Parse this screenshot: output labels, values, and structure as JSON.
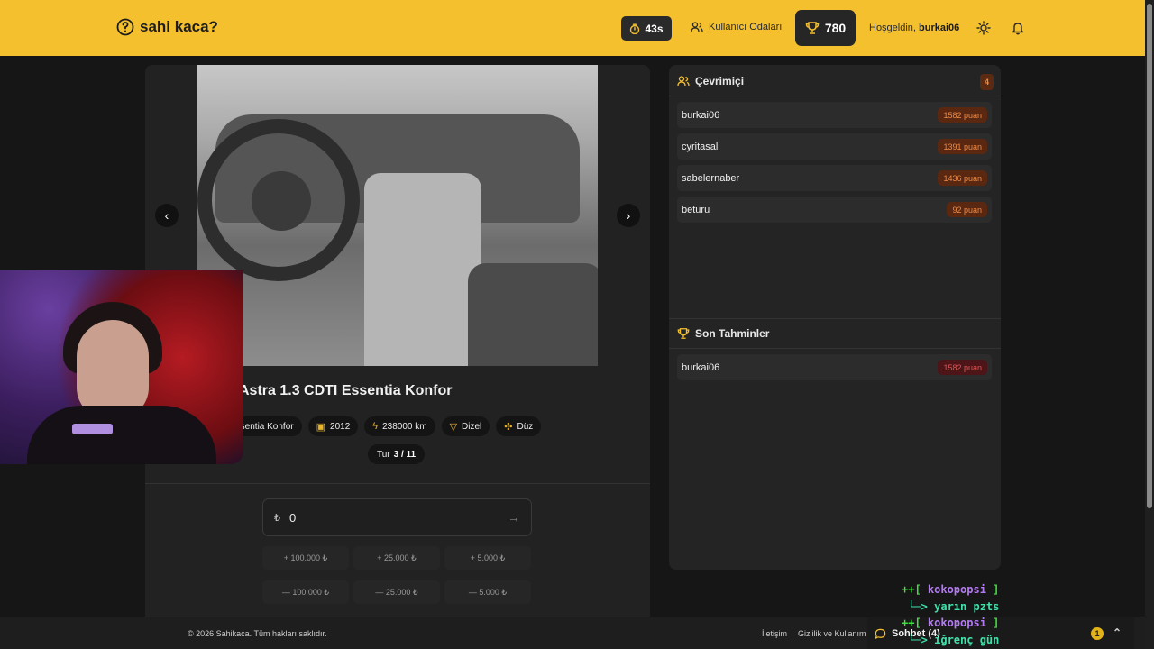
{
  "header": {
    "logo_text": "sahi kaca?",
    "timer": "43s",
    "rooms_label": "Kullanıcı Odaları",
    "score": "780",
    "welcome_prefix": "Hoşgeldin,",
    "username": "burkai06"
  },
  "car": {
    "title": "Astra 1.3 CDTI Essentia Konfor",
    "chips": [
      {
        "icon": "tag-icon",
        "text": "Essentia Konfor"
      },
      {
        "icon": "calendar-icon",
        "text": "2012"
      },
      {
        "icon": "bolt-icon",
        "text": "238000 km"
      },
      {
        "icon": "fuel-icon",
        "text": "Dizel"
      },
      {
        "icon": "gear-icon",
        "text": "Düz"
      }
    ],
    "round_label": "Tur",
    "round_value": "3 / 11"
  },
  "guess": {
    "currency": "₺",
    "value": "0",
    "adjust_buttons": [
      "+ 100.000 ₺",
      "+ 25.000 ₺",
      "+ 5.000 ₺",
      "— 100.000 ₺",
      "— 25.000 ₺",
      "— 5.000 ₺"
    ]
  },
  "online": {
    "title": "Çevrimiçi",
    "count": "4",
    "users": [
      {
        "name": "burkai06",
        "points": "1582 puan"
      },
      {
        "name": "cyritasal",
        "points": "1391 puan"
      },
      {
        "name": "sabelernaber",
        "points": "1436 puan"
      },
      {
        "name": "beturu",
        "points": "92 puan"
      }
    ]
  },
  "recent_guesses": {
    "title": "Son Tahminler",
    "entries": [
      {
        "name": "burkai06",
        "points": "1582 puan"
      }
    ]
  },
  "footer": {
    "copyright": "© 2026 Sahikaca. Tüm hakları saklıdır.",
    "contact": "İletişim",
    "privacy": "Gizlilik ve Kullanım",
    "chat_label": "Sohbet (4)",
    "chat_notif": "1"
  },
  "chat_overlay": [
    {
      "prefix": "++[ ",
      "name": "kokopopsi",
      "suffix": " ]"
    },
    {
      "prefix": " └─> ",
      "msg": "yarın pzts"
    },
    {
      "prefix": "++[ ",
      "name": "kokopopsi",
      "suffix": " ]"
    },
    {
      "prefix": " └─> ",
      "msg": "iğrenç gün"
    }
  ],
  "colors": {
    "accent": "#f5c02e",
    "background": "#161616",
    "panel": "#242424",
    "points_orange": "#ee8a44",
    "points_red": "#e05454"
  }
}
